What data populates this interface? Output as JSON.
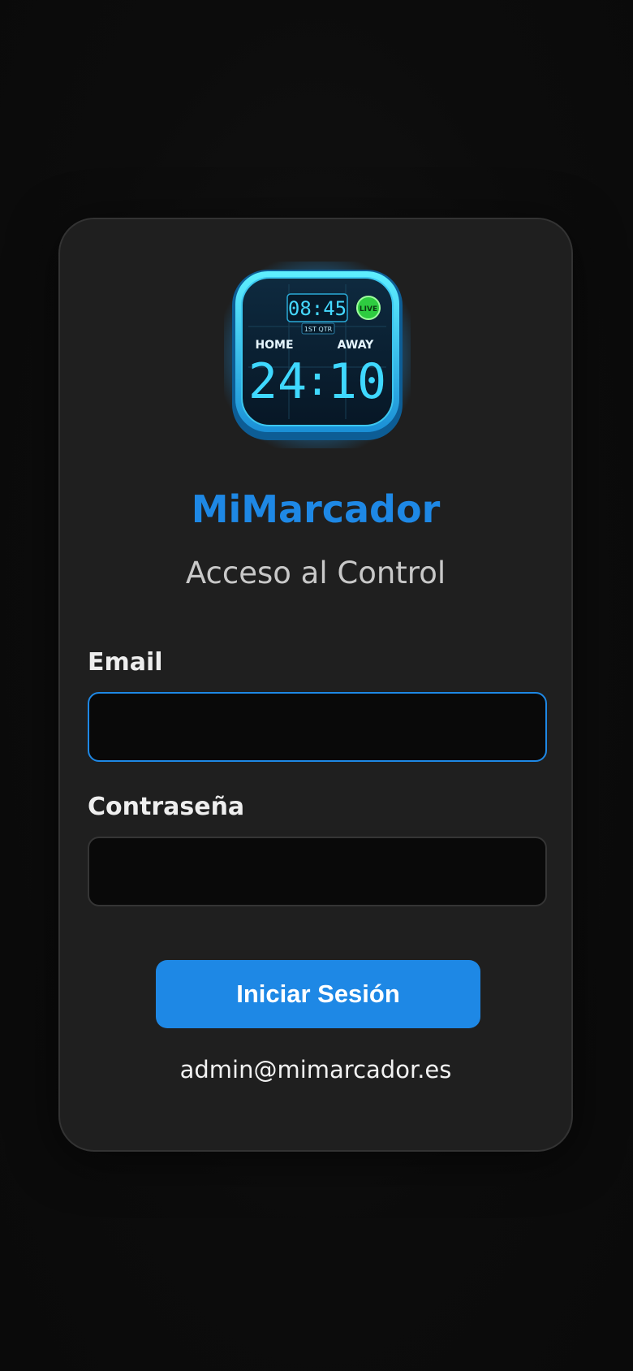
{
  "logo": {
    "clock": "08:45",
    "period": "1ST QTR",
    "live": "LIVE",
    "home_label": "HOME",
    "away_label": "AWAY",
    "home_score": "24",
    "away_score": "10",
    "score_separator": ":"
  },
  "header": {
    "title": "MiMarcador",
    "subtitle": "Acceso al Control"
  },
  "form": {
    "email_label": "Email",
    "email_value": "",
    "password_label": "Contraseña",
    "password_value": "",
    "submit_label": "Iniciar Sesión"
  },
  "footer": {
    "contact_email": "admin@mimarcador.es"
  },
  "colors": {
    "accent": "#1e88e5",
    "card_bg": "#1f1f1f",
    "page_bg": "#0c0c0c",
    "logo_glow": "#27c6ff",
    "live_badge": "#2ecc40"
  },
  "icons": [
    "scoreboard-app-icon"
  ]
}
